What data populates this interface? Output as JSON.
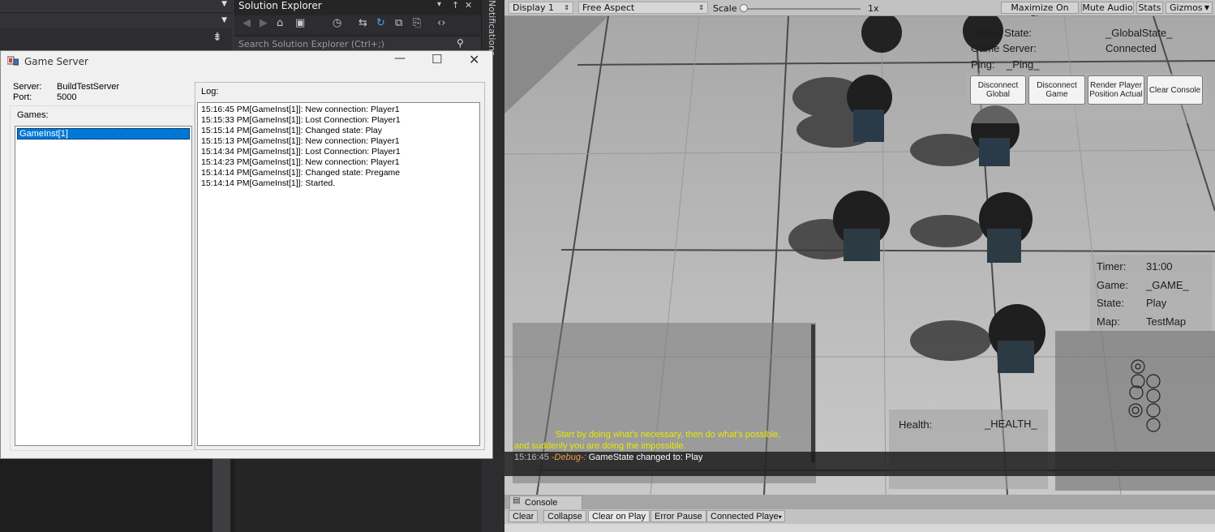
{
  "vs": {
    "solution_explorer_title": "Solution Explorer",
    "search_placeholder": "Search Solution Explorer (Ctrl+;)",
    "notifications_label": "Notifications",
    "pin_glyph": "↑",
    "close_glyph": "✕",
    "dropdown_glyph": "▾"
  },
  "game_server": {
    "title": "Game Server",
    "server_label": "Server:",
    "server_value": "BuildTestServer",
    "port_label": "Port:",
    "port_value": "5000",
    "games_label": "Games:",
    "games": [
      "GameInst[1]"
    ],
    "log_label": "Log:",
    "log": [
      "15:16:45 PM[GameInst[1]]: New connection: Player1",
      "15:15:33 PM[GameInst[1]]: Lost Connection: Player1",
      "15:15:14 PM[GameInst[1]]: Changed state: Play",
      "15:15:13 PM[GameInst[1]]: New connection: Player1",
      "15:14:34 PM[GameInst[1]]: Lost Connection: Player1",
      "15:14:23 PM[GameInst[1]]: New connection: Player1",
      "15:14:14 PM[GameInst[1]]: Changed state: Pregame",
      "15:14:14 PM[GameInst[1]]: Started."
    ]
  },
  "unity": {
    "display": "Display 1",
    "aspect": "Free Aspect",
    "scale_label": "Scale",
    "scale_value": "1x",
    "maximize": "Maximize On Play",
    "mute": "Mute Audio",
    "stats": "Stats",
    "gizmos": "Gizmos",
    "hud": {
      "global_state_label": "Global State:",
      "global_state_value": "_GlobalState_",
      "game_server_label": "Game Server:",
      "game_server_value": "Connected",
      "ping_label": "Ping:",
      "ping_value": "_Ping_",
      "buttons": [
        "Disconnect Global",
        "Disconnect Game",
        "Render Player Position Actual",
        "Clear Console"
      ],
      "timer_label": "Timer:",
      "timer_value": "31:00",
      "game_label": "Game:",
      "game_value": "_GAME_",
      "state_label": "State:",
      "state_value": "Play",
      "map_label": "Map:",
      "map_value": "TestMap",
      "health_label": "Health:",
      "health_value": "_HEALTH_",
      "quote_line1": "Start by doing what's necessary, then do what's possible,",
      "quote_line2": "and suddenly you are doing the impossible.",
      "debug_time": "15:16:45",
      "debug_tag": "-Debug-:",
      "debug_msg": "GameState changed to: Play"
    },
    "console": {
      "tab": "Console",
      "clear": "Clear",
      "collapse": "Collapse",
      "clear_on_play": "Clear on Play",
      "error_pause": "Error Pause",
      "connected_player": "Connected Playe"
    },
    "colors": {
      "quote": "#e8e800",
      "debug_tag": "#e8a040",
      "hud_button_bg": "#f3f3f3"
    }
  }
}
